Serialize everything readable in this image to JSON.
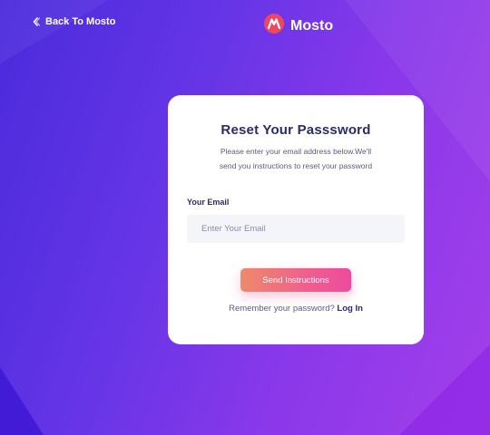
{
  "header": {
    "back_label": "Back To Mosto",
    "brand_name": "Mosto"
  },
  "card": {
    "title": "Reset Your Passsword",
    "description_line1": "Please enter your email address below.We'll",
    "description_line2": "send you instructions to reset your password",
    "email_label": "Your Email",
    "email_placeholder": "Enter Your Email",
    "email_value": "",
    "submit_label": "Send Instructions",
    "remember_text": "Remember your password?",
    "login_link": "Log In"
  },
  "colors": {
    "background_start": "#4a2bdc",
    "background_end": "#a33fea",
    "brand_red": "#f0475e",
    "title_navy": "#2c2a6b",
    "button_start": "#ee8a6a",
    "button_end": "#ee4a9e"
  },
  "icons": {
    "back": "chevron-left-icon",
    "logo": "mosto-logo-icon"
  }
}
